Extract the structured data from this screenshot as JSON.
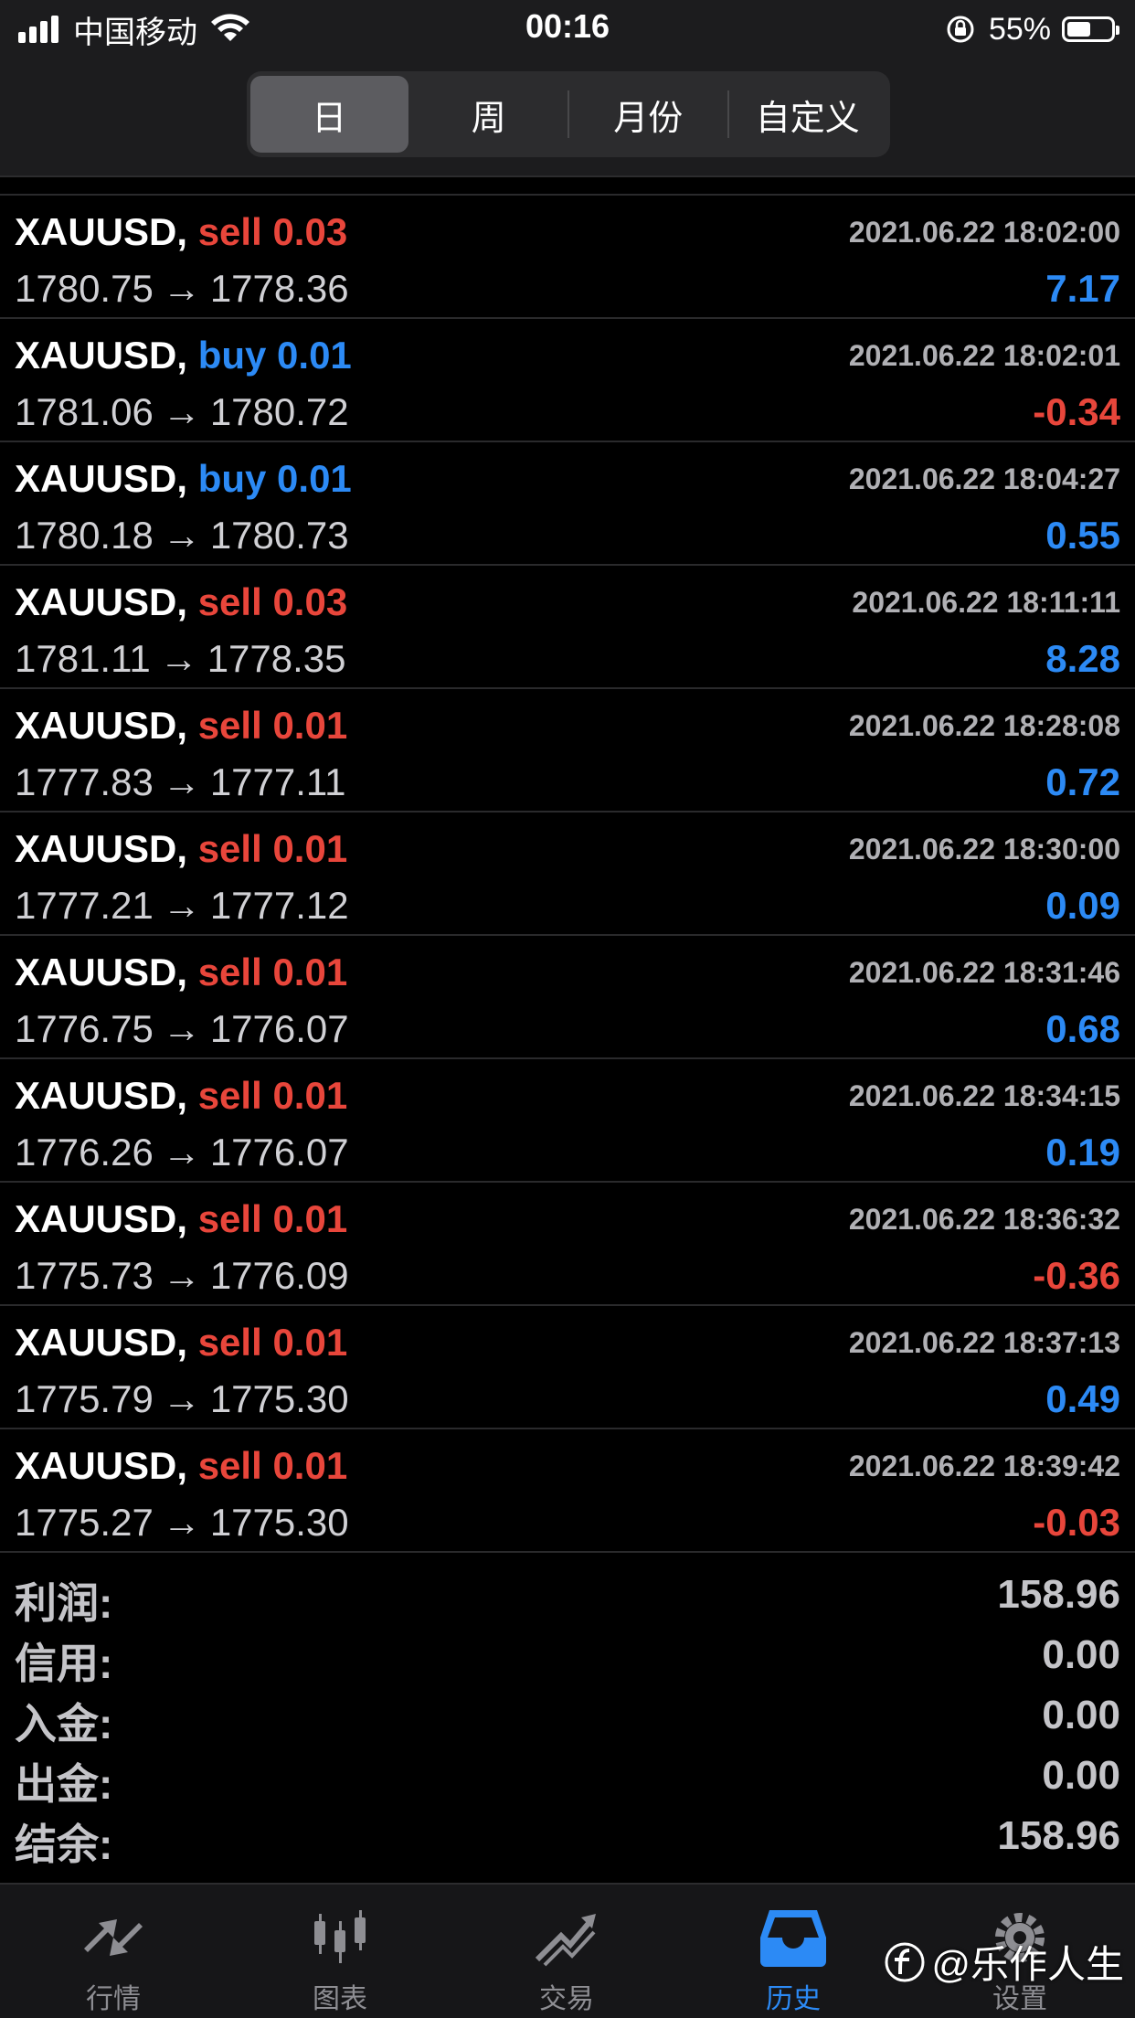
{
  "status_bar": {
    "carrier": "中国移动",
    "time": "00:16",
    "battery": "55%",
    "battery_level": 0.55
  },
  "segments": [
    {
      "label": "日",
      "active": true
    },
    {
      "label": "周",
      "active": false
    },
    {
      "label": "月份",
      "active": false
    },
    {
      "label": "自定义",
      "active": false
    }
  ],
  "trades": [
    {
      "symbol": "XAUUSD,",
      "side": "sell",
      "volume": "0.03",
      "time": "2021.06.22 18:02:00",
      "open": "1780.75",
      "arrow": "→",
      "close": "1778.36",
      "profit": "7.17"
    },
    {
      "symbol": "XAUUSD,",
      "side": "buy",
      "volume": "0.01",
      "time": "2021.06.22 18:02:01",
      "open": "1781.06",
      "arrow": "→",
      "close": "1780.72",
      "profit": "-0.34"
    },
    {
      "symbol": "XAUUSD,",
      "side": "buy",
      "volume": "0.01",
      "time": "2021.06.22 18:04:27",
      "open": "1780.18",
      "arrow": "→",
      "close": "1780.73",
      "profit": "0.55"
    },
    {
      "symbol": "XAUUSD,",
      "side": "sell",
      "volume": "0.03",
      "time": "2021.06.22 18:11:11",
      "open": "1781.11",
      "arrow": "→",
      "close": "1778.35",
      "profit": "8.28"
    },
    {
      "symbol": "XAUUSD,",
      "side": "sell",
      "volume": "0.01",
      "time": "2021.06.22 18:28:08",
      "open": "1777.83",
      "arrow": "→",
      "close": "1777.11",
      "profit": "0.72"
    },
    {
      "symbol": "XAUUSD,",
      "side": "sell",
      "volume": "0.01",
      "time": "2021.06.22 18:30:00",
      "open": "1777.21",
      "arrow": "→",
      "close": "1777.12",
      "profit": "0.09"
    },
    {
      "symbol": "XAUUSD,",
      "side": "sell",
      "volume": "0.01",
      "time": "2021.06.22 18:31:46",
      "open": "1776.75",
      "arrow": "→",
      "close": "1776.07",
      "profit": "0.68"
    },
    {
      "symbol": "XAUUSD,",
      "side": "sell",
      "volume": "0.01",
      "time": "2021.06.22 18:34:15",
      "open": "1776.26",
      "arrow": "→",
      "close": "1776.07",
      "profit": "0.19"
    },
    {
      "symbol": "XAUUSD,",
      "side": "sell",
      "volume": "0.01",
      "time": "2021.06.22 18:36:32",
      "open": "1775.73",
      "arrow": "→",
      "close": "1776.09",
      "profit": "-0.36"
    },
    {
      "symbol": "XAUUSD,",
      "side": "sell",
      "volume": "0.01",
      "time": "2021.06.22 18:37:13",
      "open": "1775.79",
      "arrow": "→",
      "close": "1775.30",
      "profit": "0.49"
    },
    {
      "symbol": "XAUUSD,",
      "side": "sell",
      "volume": "0.01",
      "time": "2021.06.22 18:39:42",
      "open": "1775.27",
      "arrow": "→",
      "close": "1775.30",
      "profit": "-0.03"
    }
  ],
  "summary": [
    {
      "label": "利润:",
      "value": "158.96"
    },
    {
      "label": "信用:",
      "value": "0.00"
    },
    {
      "label": "入金:",
      "value": "0.00"
    },
    {
      "label": "出金:",
      "value": "0.00"
    },
    {
      "label": "结余:",
      "value": "158.96"
    }
  ],
  "tabs": [
    {
      "label": "行情",
      "icon": "quotes-arrows-icon",
      "active": false
    },
    {
      "label": "图表",
      "icon": "candlestick-chart-icon",
      "active": false
    },
    {
      "label": "交易",
      "icon": "trade-trend-icon",
      "active": false
    },
    {
      "label": "历史",
      "icon": "history-inbox-icon",
      "active": true
    },
    {
      "label": "设置",
      "icon": "gear-icon",
      "active": false
    }
  ],
  "colors": {
    "sell": "#e8463b",
    "buy": "#2c8af5",
    "profit_positive": "#2c8af5",
    "profit_negative": "#e8463b",
    "tab_active": "#2c8af5"
  },
  "watermark": {
    "text": "@乐作人生"
  }
}
